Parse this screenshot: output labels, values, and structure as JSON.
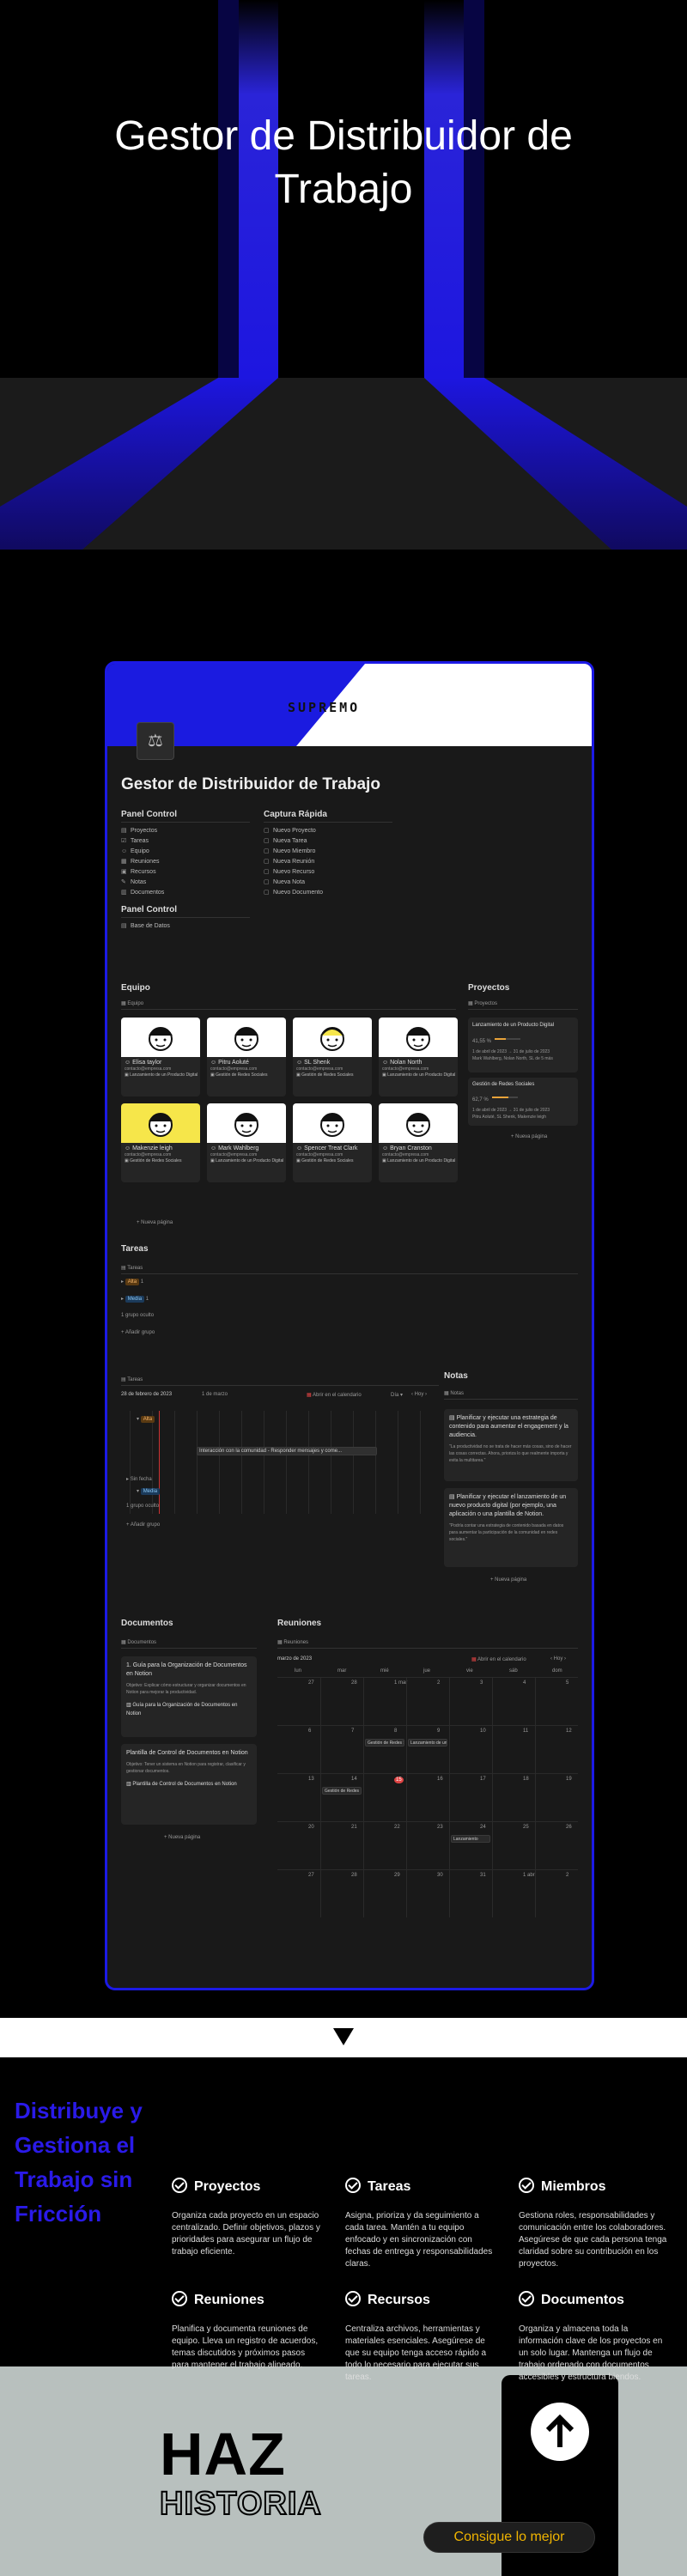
{
  "hero": {
    "title_line1": "Gestor de Distribuidor de",
    "title_line2": "Trabajo"
  },
  "app": {
    "brand": "SUPREMO",
    "title": "Gestor de Distribuidor de Trabajo",
    "control_title": "Panel Control",
    "control_items": [
      "Proyectos",
      "Tareas",
      "Equipo",
      "Reuniones",
      "Recursos",
      "Notas",
      "Documentos"
    ],
    "control2_title": "Panel Control",
    "control2_items": [
      "Base de Datos"
    ],
    "quick_title": "Captura Rápida",
    "quick_items": [
      "Nuevo Proyecto",
      "Nueva Tarea",
      "Nuevo Miembro",
      "Nueva Reunión",
      "Nuevo Recurso",
      "Nueva Nota",
      "Nuevo Documento"
    ],
    "team_title": "Equipo",
    "team_view": "Equipo",
    "team": [
      {
        "name": "Elisa taylor",
        "mail": "contacto@empresa.com",
        "tag": "Lanzamiento de un Producto Digital"
      },
      {
        "name": "Pitru Aoluté",
        "mail": "contacto@empresa.com",
        "tag": "Gestión de Redes Sociales"
      },
      {
        "name": "SL Shenk",
        "mail": "contacto@empresa.com",
        "tag": "Gestión de Redes Sociales"
      },
      {
        "name": "Nolan North",
        "mail": "contacto@empresa.com",
        "tag": "Lanzamiento de un Producto Digital"
      },
      {
        "name": "Makenzie leigh",
        "mail": "contacto@empresa.com",
        "tag": "Gestión de Redes Sociales"
      },
      {
        "name": "Mark Wahlberg",
        "mail": "contacto@empresa.com",
        "tag": "Lanzamiento de un Producto Digital"
      },
      {
        "name": "Spencer Treat Clark",
        "mail": "contacto@empresa.com",
        "tag": "Gestión de Redes Sociales"
      },
      {
        "name": "Bryan Cranston",
        "mail": "contacto@empresa.com",
        "tag": "Lanzamiento de un Producto Digital"
      }
    ],
    "new_page": "+ Nueva página",
    "projects_title": "Proyectos",
    "projects_view": "Proyectos",
    "projects": [
      {
        "name": "Lanzamiento de un Producto Digital",
        "pct": "41,55 %",
        "dates": "1 de abril de 2023 → 31 de julio de 2023",
        "people": "Mark Wahlberg, Nolan North, SL de 5 más"
      },
      {
        "name": "Gestión de Redes Sociales",
        "pct": "62,7 %",
        "dates": "1 de abril de 2023 → 31 de julio de 2023",
        "people": "Pitru Aoluté, SL Shenk, Makenzie leigh"
      }
    ],
    "tasks_title": "Tareas",
    "tasks_view": "Tareas",
    "task_groups": [
      {
        "label": "Alta",
        "count": "1"
      },
      {
        "label": "Media",
        "count": "1"
      }
    ],
    "task_hidden": "1 grupo oculto",
    "task_add": "+ Añadir grupo",
    "timeline_view": "Tareas",
    "timeline_date": "28 de febrero de 2023",
    "timeline_range": "1 de marzo",
    "timeline_open": "Abrir en el calendario",
    "timeline_day": "Día",
    "timeline_today": "Hoy",
    "timeline_bar": "Interacción con la comunidad - Responder mensajes y come...",
    "timeline_badge1": "Alta",
    "timeline_badge2": "Media",
    "timeline_nofecha": "Sin fecha",
    "timeline_hidden": "1 grupo oculto",
    "timeline_add": "+ Añadir grupo",
    "notes_title": "Notas",
    "notes_view": "Notas",
    "notes": [
      {
        "title": "Planificar y ejecutar una estrategia de contenido para aumentar el engagement y la audiencia.",
        "body": "\"La productividad no se trata de hacer más cosas, sino de hacer las cosas correctas. Ahora, prioriza lo que realmente importa y evita la multitarea.\""
      },
      {
        "title": "Planificar y ejecutar el lanzamiento de un nuevo producto digital (por ejemplo, una aplicación o una plantilla de Notion.",
        "body": "\"Podría contar una estrategia de contenido basada en datos para aumentar la participación de la comunidad en redes sociales.\""
      }
    ],
    "docs_title": "Documentos",
    "docs_view": "Documentos",
    "docs": [
      {
        "title": "1. Guía para la Organización de Documentos en Notion",
        "body": "Objetivo: Explicar cómo estructurar y organizar documentos en Notion para mejorar la productividad.",
        "foot": "Guía para la Organización de Documentos en Notion"
      },
      {
        "title": "Plantilla de Control de Documentos en Notion",
        "body": "Objetivo: Tener un sistema en Notion para registrar, clasificar y gestionar documentos.",
        "foot": "Plantilla de Control de Documentos en Notion"
      }
    ],
    "meet_title": "Reuniones",
    "meet_view": "Reuniones",
    "meet_month": "marzo de 2023",
    "meet_open": "Abrir en el calendario",
    "meet_today": "Hoy",
    "weekdays": [
      "lun",
      "mar",
      "mié",
      "jue",
      "vie",
      "sáb",
      "dom"
    ],
    "weeks": [
      [
        "27",
        "28",
        "1 mar",
        "2",
        "3",
        "4",
        "5"
      ],
      [
        "6",
        "7",
        "8",
        "9",
        "10",
        "11",
        "12"
      ],
      [
        "13",
        "14",
        "15",
        "16",
        "17",
        "18",
        "19"
      ],
      [
        "20",
        "21",
        "22",
        "23",
        "24",
        "25",
        "26"
      ],
      [
        "27",
        "28",
        "29",
        "30",
        "31",
        "1 abr",
        "2"
      ]
    ],
    "events": [
      {
        "label": "Gestión de Redes Sociales"
      },
      {
        "label": "Lanzamiento de un Producto Digital"
      },
      {
        "label": "Gestión de Redes"
      },
      {
        "label": "Lanzamiento"
      }
    ]
  },
  "features": {
    "heading": "Distribuye y Gestiona el Trabajo sin Fricción",
    "items": [
      {
        "title": "Proyectos",
        "desc": "Organiza cada proyecto en un espacio centralizado. Definir objetivos, plazos y prioridades para asegurar un flujo de trabajo eficiente."
      },
      {
        "title": "Tareas",
        "desc": "Asigna, prioriza y da seguimiento a cada tarea. Mantén a tu equipo enfocado y en sincronización con fechas de entrega y responsabilidades claras."
      },
      {
        "title": "Miembros",
        "desc": "Gestiona roles, responsabilidades y comunicación entre los colaboradores. Asegúrese de que cada persona tenga claridad sobre su contribución en los proyectos."
      },
      {
        "title": "Reuniones",
        "desc": "Planifica y documenta reuniones de equipo. Lleva un registro de acuerdos, temas discutidos y próximos pasos para mantener el trabajo alineado."
      },
      {
        "title": "Recursos",
        "desc": "Centraliza archivos, herramientas y materiales esenciales. Asegúrese de que su equipo tenga acceso rápido a todo lo necesario para ejecutar sus tareas."
      },
      {
        "title": "Documentos",
        "desc": "Organiza y almacena toda la información clave de los proyectos en un solo lugar. Mantenga un flujo de trabajo ordenado con documentos accesibles y estructura biendos."
      }
    ]
  },
  "footer": {
    "haz": "HAZ",
    "historia": "HISTORIA",
    "cta": "Consigue lo mejor"
  }
}
